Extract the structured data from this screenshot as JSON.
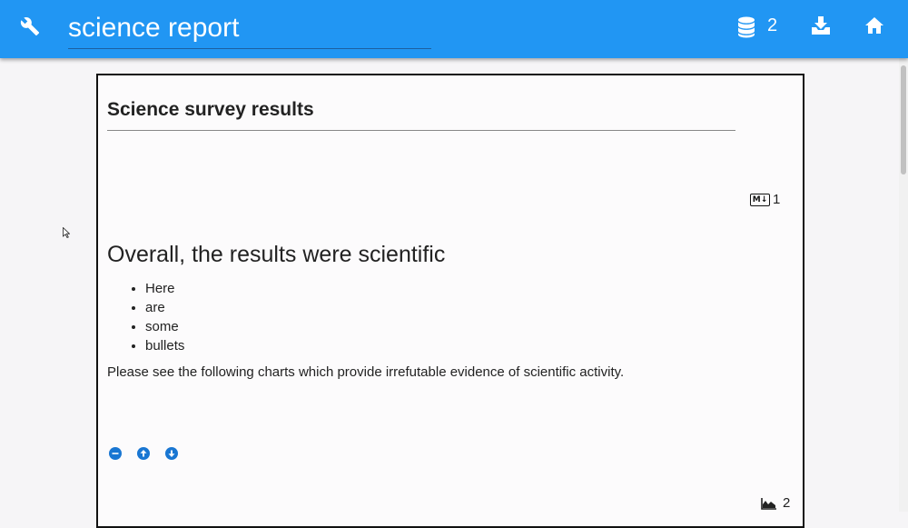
{
  "appbar": {
    "title_value": "science report",
    "dataset_count": "2",
    "icons": [
      "wrench-icon",
      "database-icon",
      "download-icon",
      "home-icon"
    ],
    "background": "#2196f3"
  },
  "document": {
    "title": "Science survey results",
    "markdown_cell": {
      "badge_text": "M↓",
      "index": "1",
      "heading": "Overall, the results were scientific",
      "bullets": [
        "Here",
        "are",
        "some",
        "bullets"
      ],
      "paragraph": "Please see the following charts which provide irrefutable evidence of scientific activity."
    },
    "cell_controls": [
      "remove-cell-icon",
      "move-up-icon",
      "move-down-icon"
    ],
    "chart_cell": {
      "index": "2",
      "icon": "area-chart-icon"
    }
  },
  "colors": {
    "accent": "#1976d2",
    "card_border": "#111111"
  }
}
